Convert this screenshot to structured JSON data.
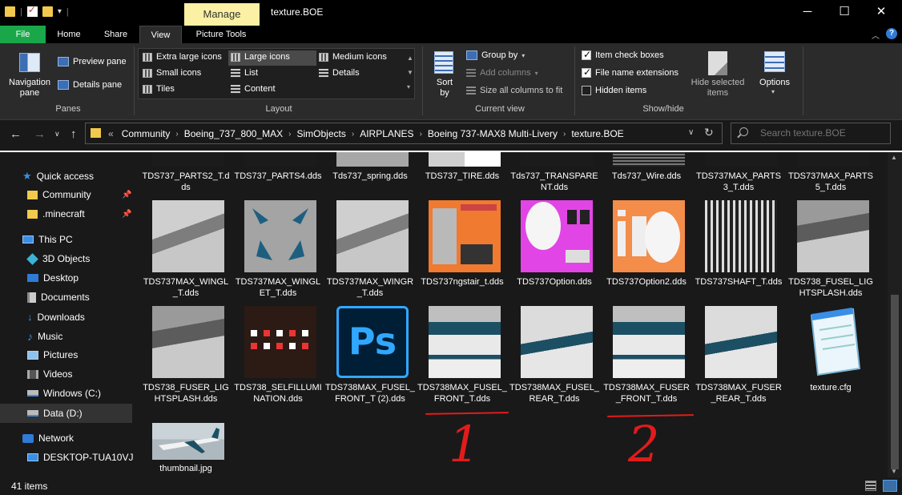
{
  "window": {
    "title": "texture.BOE",
    "manage_tab": "Manage",
    "minimize": "─",
    "maximize": "☐",
    "close": "✕"
  },
  "ribbon_tabs": [
    {
      "label": "File"
    },
    {
      "label": "Home"
    },
    {
      "label": "Share"
    },
    {
      "label": "View"
    },
    {
      "label": "Picture Tools"
    }
  ],
  "ribbon": {
    "panes": {
      "navigation_pane": "Navigation\npane",
      "preview_pane": "Preview pane",
      "details_pane": "Details pane",
      "group_label": "Panes"
    },
    "layout": {
      "items": [
        "Extra large icons",
        "Large icons",
        "Medium icons",
        "Small icons",
        "List",
        "Details",
        "Tiles",
        "Content"
      ],
      "selected": "Large icons",
      "group_label": "Layout"
    },
    "current_view": {
      "sort_by": "Sort\nby",
      "group_by": "Group by",
      "add_columns": "Add columns",
      "size_all_columns": "Size all columns to fit",
      "group_label": "Current view"
    },
    "show_hide": {
      "item_check_boxes": "Item check boxes",
      "file_name_extensions": "File name extensions",
      "hidden_items": "Hidden items",
      "hide_selected_items": "Hide selected\nitems",
      "options": "Options",
      "group_label": "Show/hide"
    }
  },
  "address": {
    "prefix": "«",
    "crumbs": [
      "Community",
      "Boeing_737_800_MAX",
      "SimObjects",
      "AIRPLANES",
      "Boeing 737-MAX8 Multi-Livery",
      "texture.BOE"
    ],
    "search_placeholder": "Search texture.BOE"
  },
  "sidebar": {
    "items": [
      {
        "label": "Quick access"
      },
      {
        "label": "Community"
      },
      {
        "label": ".minecraft"
      },
      {
        "label": "This PC"
      },
      {
        "label": "3D Objects"
      },
      {
        "label": "Desktop"
      },
      {
        "label": "Documents"
      },
      {
        "label": "Downloads"
      },
      {
        "label": "Music"
      },
      {
        "label": "Pictures"
      },
      {
        "label": "Videos"
      },
      {
        "label": "Windows (C:)"
      },
      {
        "label": "Data (D:)"
      },
      {
        "label": "Network"
      },
      {
        "label": "DESKTOP-TUA10VJ"
      }
    ]
  },
  "files": [
    {
      "name": "TDS737_PARTS2_T.dds"
    },
    {
      "name": "TDS737_PARTS4.dds"
    },
    {
      "name": "Tds737_spring.dds"
    },
    {
      "name": "TDS737_TIRE.dds"
    },
    {
      "name": "Tds737_TRANSPARENT.dds"
    },
    {
      "name": "Tds737_Wire.dds"
    },
    {
      "name": "TDS737MAX_PARTS3_T.dds"
    },
    {
      "name": "TDS737MAX_PARTS5_T.dds"
    },
    {
      "name": "TDS737MAX_WINGL_T.dds"
    },
    {
      "name": "TDS737MAX_WINGLET_T.dds"
    },
    {
      "name": "TDS737MAX_WINGR_T.dds"
    },
    {
      "name": "TDS737ngstair_t.dds"
    },
    {
      "name": "TDS737Option.dds"
    },
    {
      "name": "TDS737Option2.dds"
    },
    {
      "name": "TDS737SHAFT_T.dds"
    },
    {
      "name": "TDS738_FUSEL_LIGHTSPLASH.dds"
    },
    {
      "name": "TDS738_FUSER_LIGHTSPLASH.dds"
    },
    {
      "name": "TDS738_SELFILLUMINATION.dds"
    },
    {
      "name": "TDS738MAX_FUSEL_FRONT_T (2).dds"
    },
    {
      "name": "TDS738MAX_FUSEL_FRONT_T.dds"
    },
    {
      "name": "TDS738MAX_FUSEL_REAR_T.dds"
    },
    {
      "name": "TDS738MAX_FUSER_FRONT_T.dds"
    },
    {
      "name": "TDS738MAX_FUSER_REAR_T.dds"
    },
    {
      "name": "texture.cfg"
    },
    {
      "name": "thumbnail.jpg"
    }
  ],
  "ps_glyph": "Ps",
  "status": {
    "item_count": "41 items"
  },
  "annotations": {
    "one": "1",
    "two": "2"
  },
  "colors": {
    "accent_file_tab": "#19a74a",
    "manage_tab": "#fbf0a4",
    "annotation_red": "#e21b1b"
  }
}
